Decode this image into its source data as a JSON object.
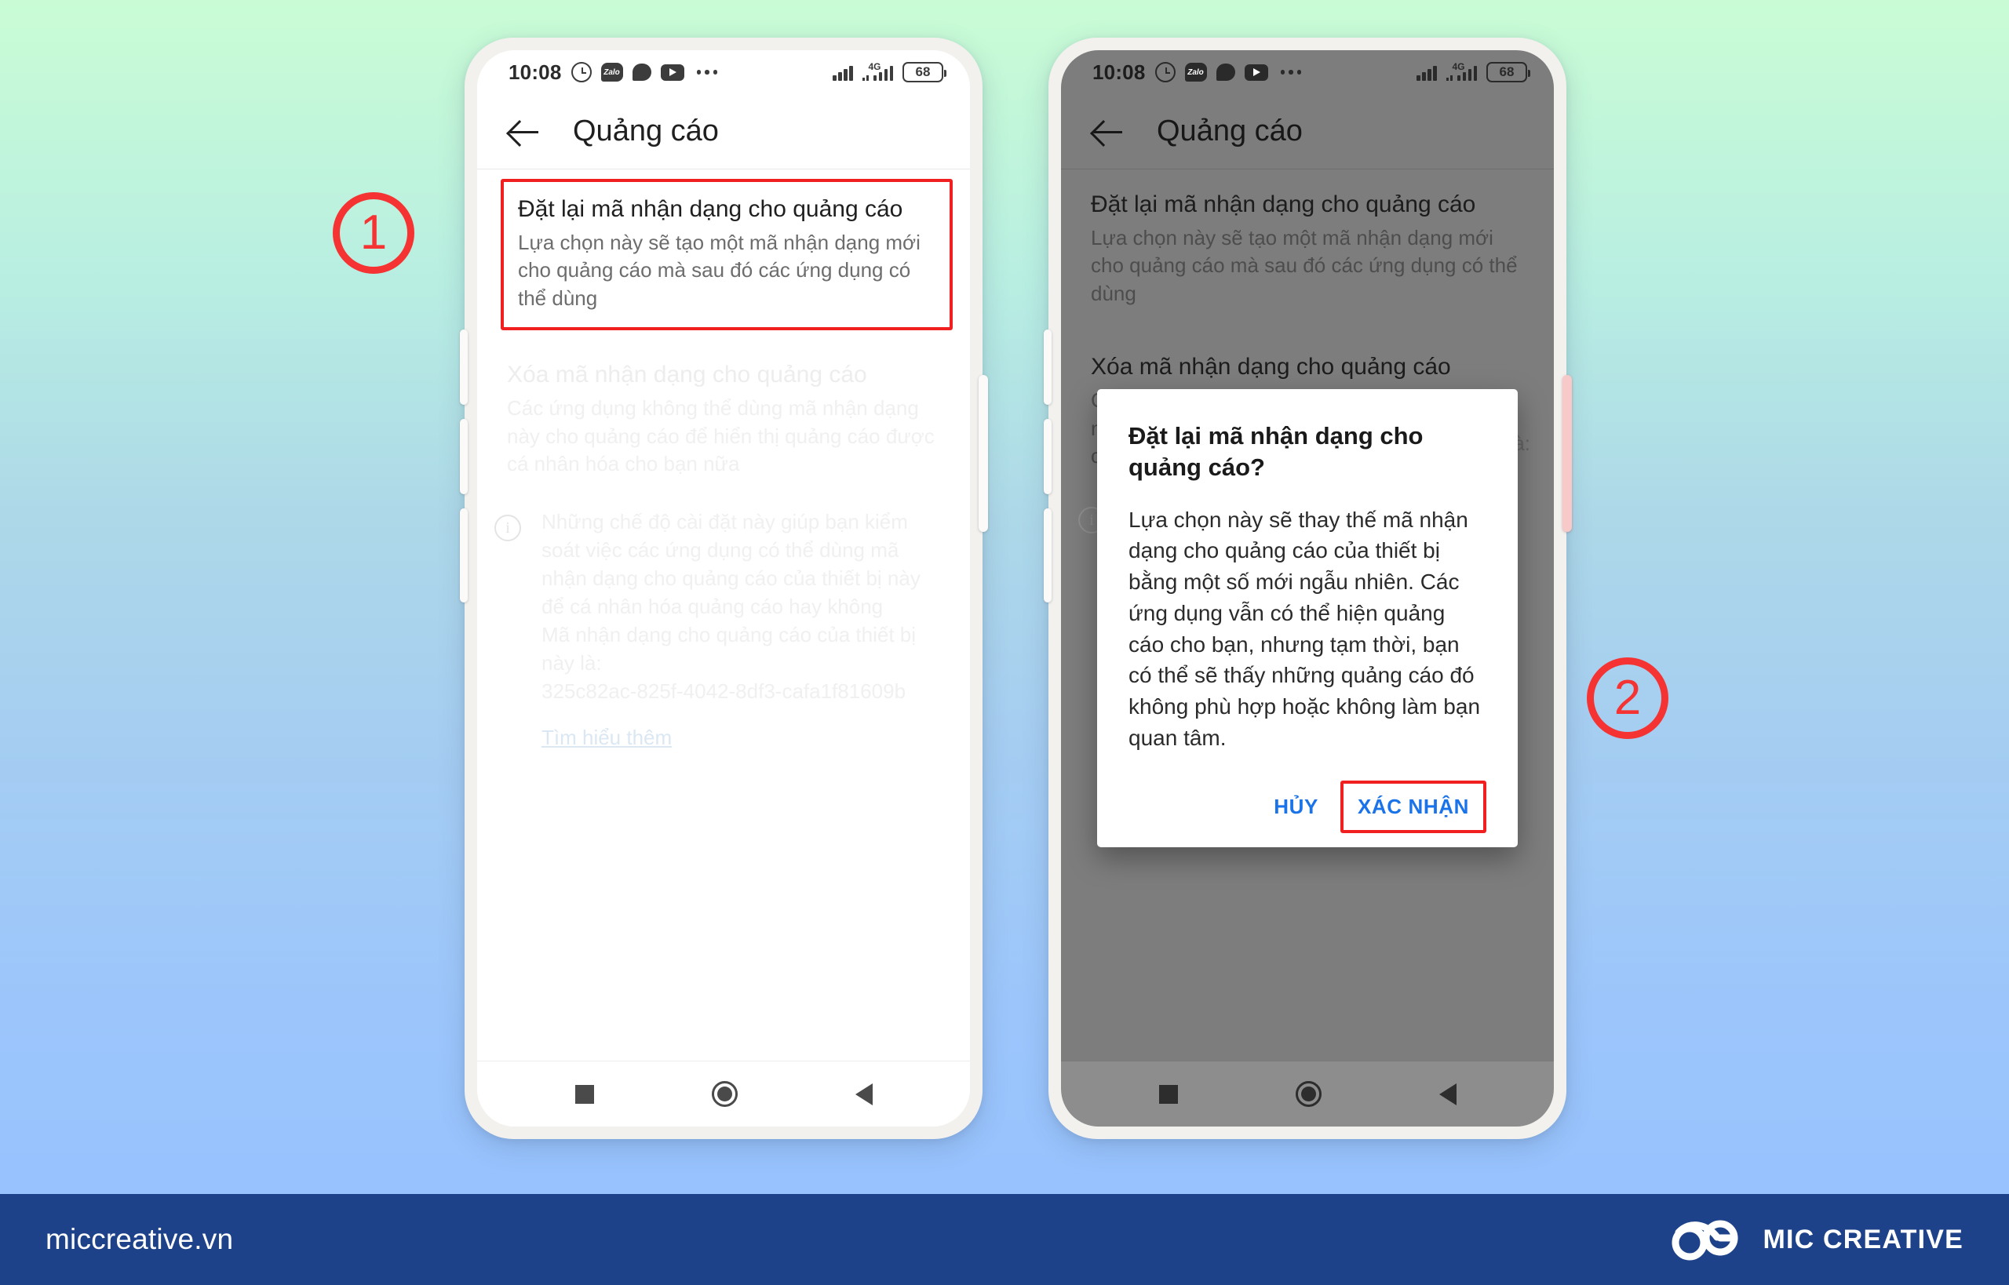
{
  "background": {
    "top_color": "#c9fcd5",
    "bottom_color": "#95c0fd"
  },
  "accent": {
    "highlight_red": "#f02020",
    "badge_red": "#f53333",
    "link_blue": "#1a73e8",
    "footer_blue": "#1d4289"
  },
  "status_bar": {
    "time": "10:08",
    "icons": [
      "alarm-clock-icon",
      "zalo-icon",
      "chat-bubble-icon",
      "youtube-icon",
      "more-dots-icon"
    ],
    "zalo_label": "Zalo",
    "network_label": "4G",
    "battery_level": "68"
  },
  "app_bar": {
    "back_label": "back-arrow-icon",
    "title": "Quảng cáo"
  },
  "nav_bar": {
    "recents": "square-icon",
    "home": "circle-icon",
    "back": "triangle-back-icon"
  },
  "phone1": {
    "highlighted_pref": {
      "title": "Đặt lại mã nhận dạng cho quảng cáo",
      "subtitle": "Lựa chọn này sẽ tạo một mã nhận dạng mới cho quảng cáo mà sau đó các ứng dụng có thể dùng"
    },
    "second_pref": {
      "title": "Xóa mã nhận dạng cho quảng cáo",
      "subtitle": "Các ứng dụng không thể dùng mã nhận dạng này cho quảng cáo để hiển thị quảng cáo được cá nhân hóa cho bạn nữa"
    },
    "info": {
      "paragraph": "Những chế độ cài đặt này giúp bạn kiểm soát việc các ứng dụng có thể dùng mã nhận dạng cho quảng cáo của thiết bị này để cá nhân hóa quảng cáo hay không",
      "device_id_label": "Mã nhận dạng cho quảng cáo của thiết bị này là:",
      "device_id_value": "325c82ac-825f-4042-8df3-cafa1f81609b",
      "learn_more": "Tìm hiểu thêm"
    }
  },
  "phone2": {
    "first_pref": {
      "title": "Đặt lại mã nhận dạng cho quảng cáo",
      "subtitle": "Lựa chọn này sẽ tạo một mã nhận dạng mới cho quảng cáo mà sau đó các ứng dụng có thể dùng"
    },
    "second_pref": {
      "title": "Xóa mã nhận dạng cho quảng cáo",
      "subtitle": "Các ứng dụng không thể dùng mã nhận dạng này cho quảng cáo để hiển thị quảng cáo được cá nhân hóa cho bạn nữa"
    },
    "behind_text": "à:",
    "dialog": {
      "title": "Đặt lại mã nhận dạng cho quảng cáo?",
      "body": "Lựa chọn này sẽ thay thế mã nhận dạng cho quảng cáo của thiết bị bằng một số mới ngẫu nhiên. Các ứng dụng vẫn có thể hiện quảng cáo cho bạn, nhưng tạm thời, bạn có thể sẽ thấy những quảng cáo đó không phù hợp hoặc không làm bạn quan tâm.",
      "cancel_label": "HỦY",
      "confirm_label": "XÁC NHẬN"
    }
  },
  "badges": {
    "step1": "1",
    "step2": "2"
  },
  "footer": {
    "url": "miccreative.vn",
    "brand": "MIC CREATIVE",
    "logo": "infinity-loop-logo"
  }
}
